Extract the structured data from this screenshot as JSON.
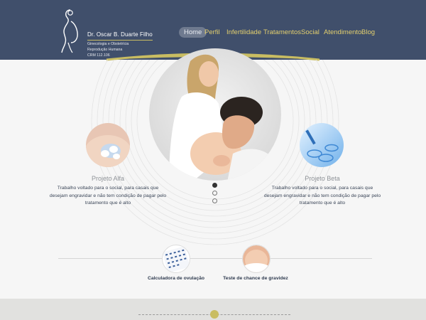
{
  "brand": {
    "name": "Dr. Oscar B. Duarte Filho",
    "line1": "Ginecologia e Obstetrícia",
    "line2": "Reprodução Humana",
    "line3": "CRM 112.106"
  },
  "nav": {
    "items": [
      {
        "label": "Home",
        "active": true
      },
      {
        "label": "Perfil",
        "active": false
      },
      {
        "label": "Infertilidade",
        "active": false
      },
      {
        "label": "Tratamentos",
        "active": false
      },
      {
        "label": "Social",
        "active": false
      },
      {
        "label": "Atendimento",
        "active": false
      },
      {
        "label": "Blog",
        "active": false
      }
    ]
  },
  "projects": {
    "left": {
      "title": "Projeto Alfa",
      "description": "Trabalho voltado para o social, para casais que desejam engravidar e não tem condição de pagar pelo tratamento que é alto"
    },
    "right": {
      "title": "Projeto Beta",
      "description": "Trabalho voltado para o social, para casais que desejam engravidar e não tem condição de pagar pelo tratamento que é alto"
    }
  },
  "slider": {
    "slide_count": 3,
    "active_index": 0
  },
  "tools": [
    {
      "label": "Calculadora de ovulação",
      "icon": "calendar-icon"
    },
    {
      "label": "Teste de chance de gravidez",
      "icon": "pregnant-belly-icon"
    }
  ],
  "colors": {
    "header_bg": "#404f6b",
    "nav_text": "#e3cf6e",
    "accent_gold": "#c9bd62",
    "page_bg": "#f6f6f6",
    "footer_bg": "#e1e1df"
  }
}
